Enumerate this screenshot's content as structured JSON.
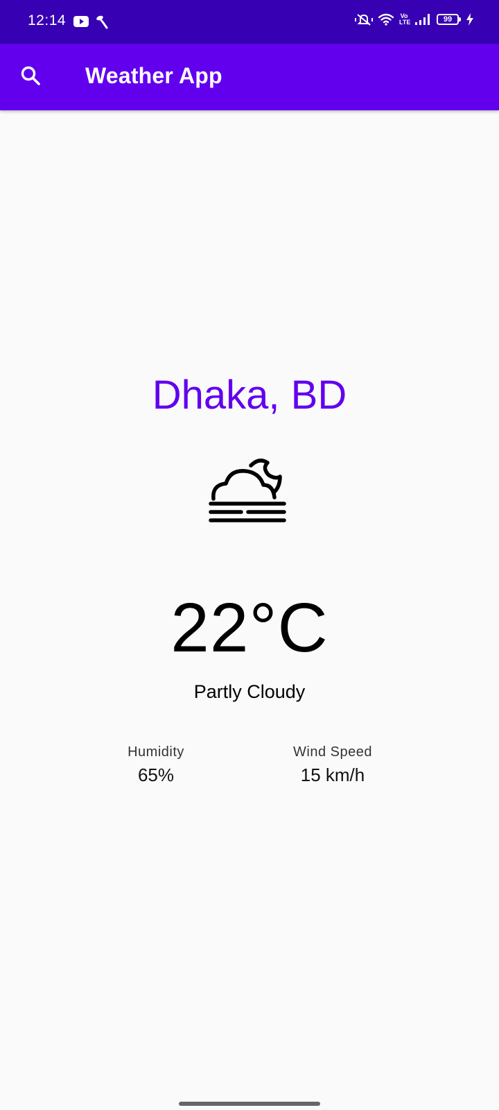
{
  "status_bar": {
    "time": "12:14",
    "volte": "Vo\nLTE",
    "battery_level": "99",
    "icons": [
      "youtube-icon",
      "telenor-icon",
      "vibrate-icon",
      "wifi-icon",
      "volte-icon",
      "signal-icon",
      "battery-icon",
      "charging-icon"
    ]
  },
  "app_bar": {
    "title": "Weather App",
    "search_icon": "search-icon",
    "background": "#6200EE"
  },
  "weather": {
    "city": "Dhaka, BD",
    "icon": "partly-cloudy-fog-night-icon",
    "temperature": "22°C",
    "description": "Partly Cloudy",
    "humidity_label": "Humidity",
    "humidity_value": "65%",
    "wind_label": "Wind Speed",
    "wind_value": "15 km/h"
  },
  "colors": {
    "status_bar": "#3700B3",
    "accent": "#6200EE",
    "background": "#FAFAFA"
  }
}
